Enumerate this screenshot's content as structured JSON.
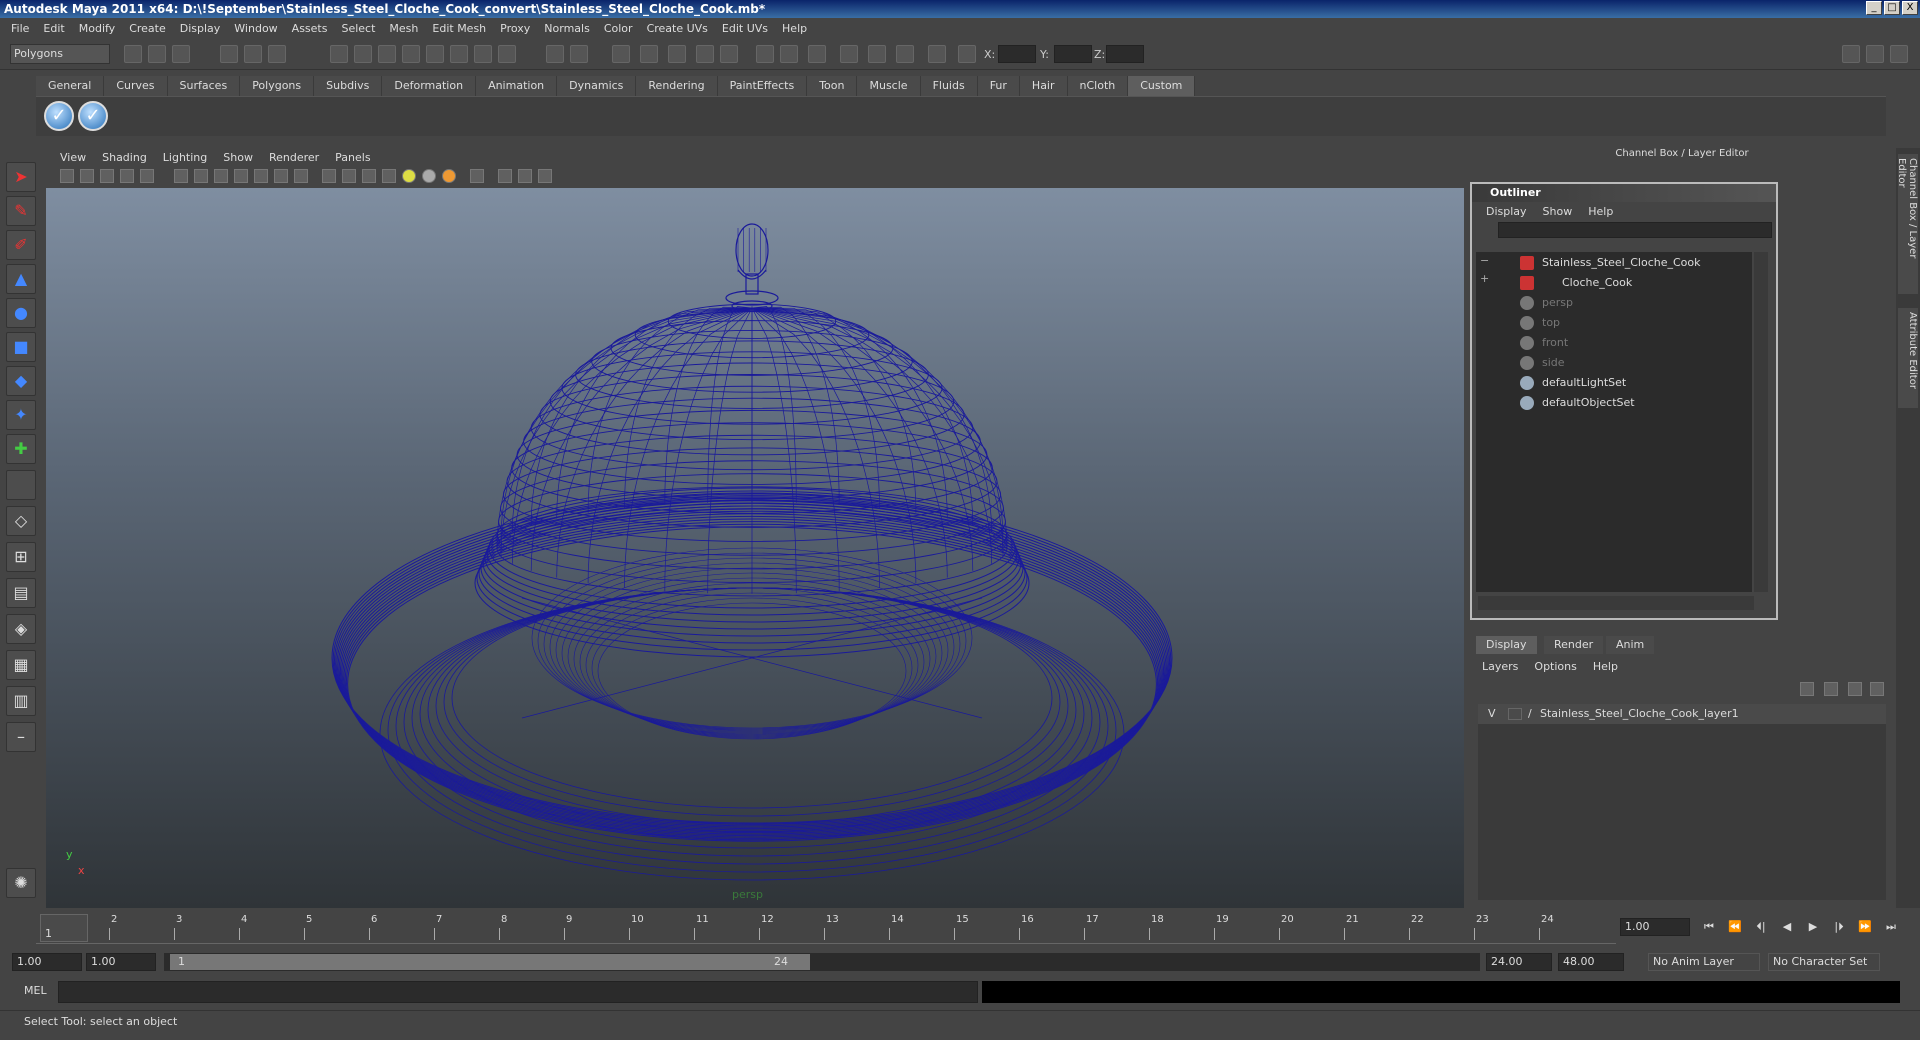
{
  "app": {
    "title": "Autodesk Maya 2011 x64: D:\\!September\\Stainless_Steel_Cloche_Cook_convert\\Stainless_Steel_Cloche_Cook.mb*",
    "min": "_",
    "max": "□",
    "close": "X"
  },
  "menubar": [
    "File",
    "Edit",
    "Modify",
    "Create",
    "Display",
    "Window",
    "Assets",
    "Select",
    "Mesh",
    "Edit Mesh",
    "Proxy",
    "Normals",
    "Color",
    "Create UVs",
    "Edit UVs",
    "Help"
  ],
  "toolbar": {
    "mode": "Polygons",
    "x_label": "X:",
    "y_label": "Y:",
    "z_label": "Z:"
  },
  "shelf": {
    "tabs": [
      "General",
      "Curves",
      "Surfaces",
      "Polygons",
      "Subdivs",
      "Deformation",
      "Animation",
      "Dynamics",
      "Rendering",
      "PaintEffects",
      "Toon",
      "Muscle",
      "Fluids",
      "Fur",
      "Hair",
      "nCloth",
      "Custom"
    ],
    "active_tab": "Custom",
    "check_glyph": "✓"
  },
  "viewport": {
    "menus": [
      "View",
      "Shading",
      "Lighting",
      "Show",
      "Renderer",
      "Panels"
    ],
    "camera_label": "persp",
    "axis_y": "y",
    "axis_x": "x",
    "wire_color": "#1a1a9a"
  },
  "channel_box": {
    "title": "Channel Box / Layer Editor"
  },
  "outliner": {
    "title": "Outliner",
    "menus": [
      "Display",
      "Show",
      "Help"
    ],
    "expand_minus": "−",
    "expand_plus": "+",
    "items": [
      {
        "label": "Stainless_Steel_Cloche_Cook",
        "dim": false
      },
      {
        "label": "Cloche_Cook",
        "dim": false
      },
      {
        "label": "persp",
        "dim": true
      },
      {
        "label": "top",
        "dim": true
      },
      {
        "label": "front",
        "dim": true
      },
      {
        "label": "side",
        "dim": true
      },
      {
        "label": "defaultLightSet",
        "dim": false
      },
      {
        "label": "defaultObjectSet",
        "dim": false
      }
    ]
  },
  "layer_editor": {
    "tabs": [
      "Display",
      "Render",
      "Anim"
    ],
    "menus": [
      "Layers",
      "Options",
      "Help"
    ],
    "layer_visible": "V",
    "layer_name": "Stainless_Steel_Cloche_Cook_layer1"
  },
  "side_tabs": [
    "Channel Box / Layer Editor",
    "Attribute Editor"
  ],
  "timeline": {
    "ticks": [
      "1",
      "2",
      "3",
      "4",
      "5",
      "6",
      "7",
      "8",
      "9",
      "10",
      "11",
      "12",
      "13",
      "14",
      "15",
      "16",
      "17",
      "18",
      "19",
      "20",
      "21",
      "22",
      "23",
      "24"
    ],
    "current_frame": "1",
    "frame_field": "1.00",
    "playback": [
      "⏮",
      "⏪",
      "⏴|",
      "◀",
      "▶",
      "|⏵",
      "⏩",
      "⏭"
    ]
  },
  "range": {
    "start": "1.00",
    "start2": "1.00",
    "slider_start": "1",
    "slider_end": "24",
    "end": "24.00",
    "end2": "48.00",
    "anim_layer": "No Anim Layer",
    "char_set": "No Character Set"
  },
  "command": {
    "label": "MEL",
    "help": "Select Tool: select an object"
  }
}
